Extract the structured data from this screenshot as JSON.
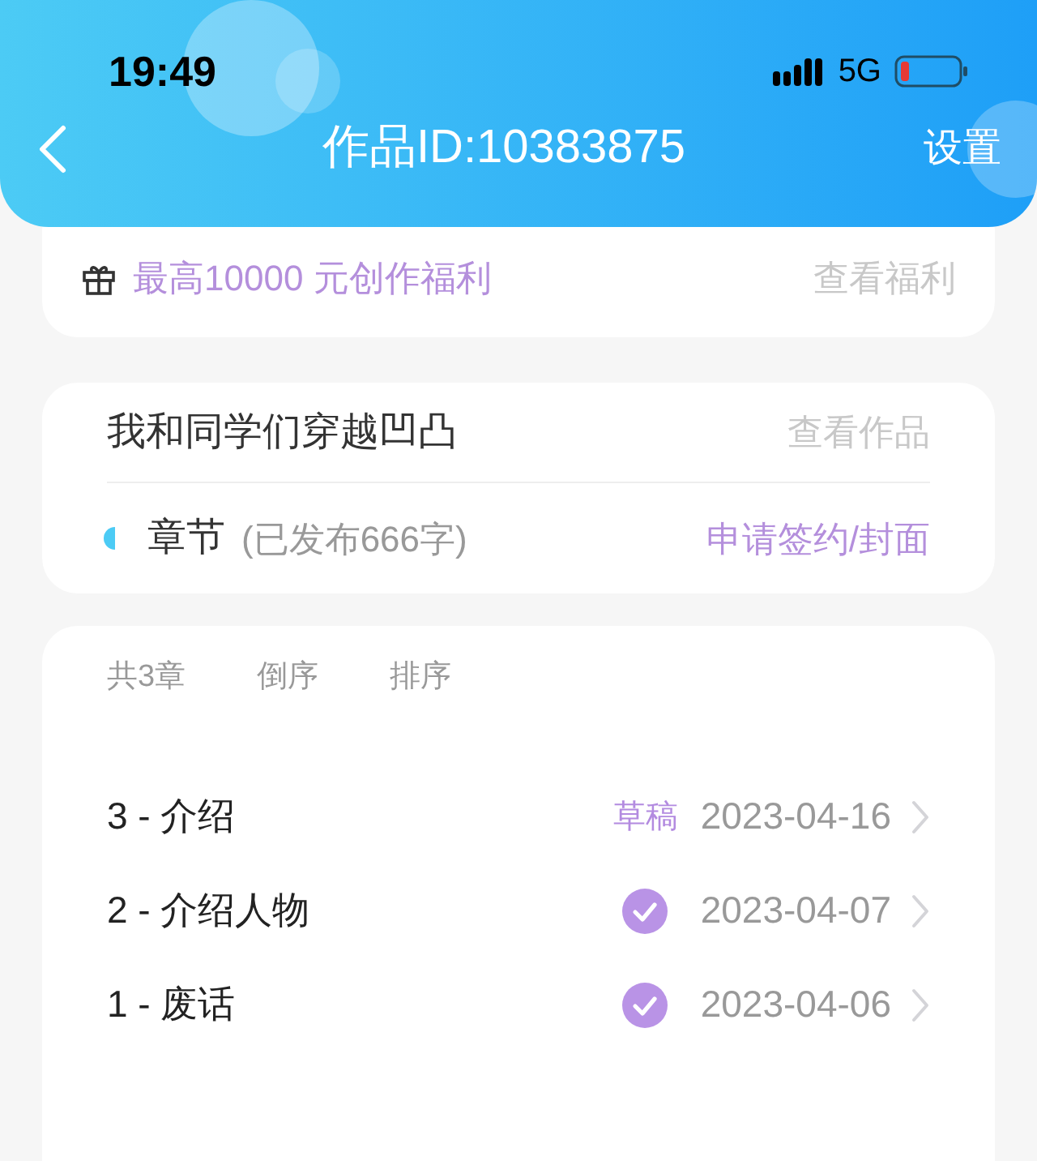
{
  "status_bar": {
    "time": "19:49",
    "network": "5G"
  },
  "nav": {
    "title": "作品ID:10383875",
    "action": "设置"
  },
  "benefit": {
    "text": "最高10000 元创作福利",
    "link": "查看福利"
  },
  "work": {
    "title": "我和同学们穿越凹凸",
    "link": "查看作品",
    "section": "章节",
    "count": "(已发布666字)",
    "action": "申请签约/封面"
  },
  "chapters_bar": {
    "total": "共3章",
    "options": [
      "倒序",
      "排序"
    ]
  },
  "chapters": [
    {
      "title": "3 - 介绍",
      "kind": "draft",
      "badge": "草稿",
      "date": "2023-04-16"
    },
    {
      "title": "2 - 介绍人物",
      "kind": "published",
      "date": "2023-04-07"
    },
    {
      "title": "1 - 废话",
      "kind": "published",
      "date": "2023-04-06"
    }
  ]
}
